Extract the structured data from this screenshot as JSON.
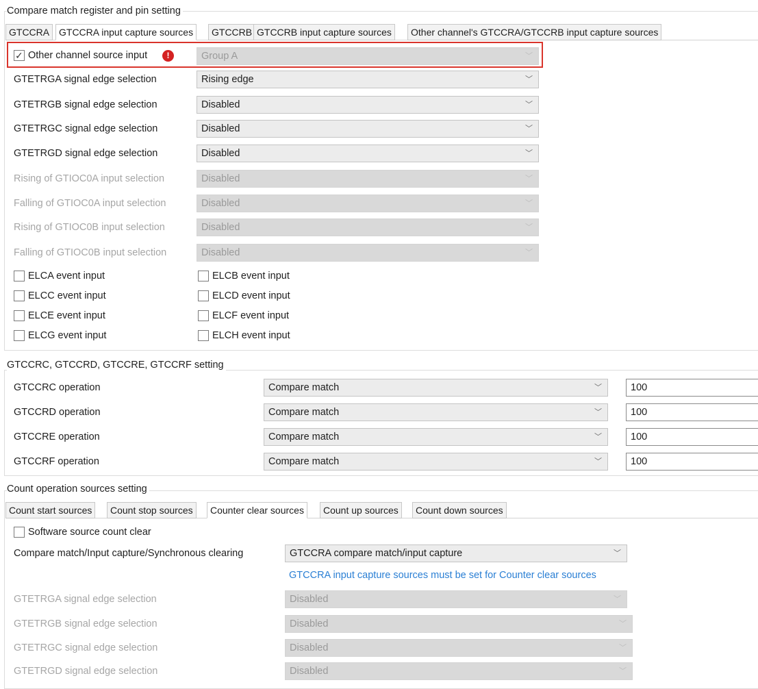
{
  "group1": {
    "title": "Compare match register and pin setting",
    "tabs": [
      "GTCCRA",
      "GTCCRA input capture sources",
      "GTCCRB",
      "GTCCRB input capture sources",
      "Other channel's GTCCRA/GTCCRB input capture sources"
    ],
    "active_tab": 1,
    "other_source": {
      "label": "Other channel source input",
      "checked": true,
      "value": "Group A"
    },
    "rows": [
      {
        "label": "GTETRGA signal edge selection",
        "value": "Rising edge",
        "enabled": true
      },
      {
        "label": "GTETRGB signal edge selection",
        "value": "Disabled",
        "enabled": true
      },
      {
        "label": "GTETRGC signal edge selection",
        "value": "Disabled",
        "enabled": true
      },
      {
        "label": "GTETRGD signal edge selection",
        "value": "Disabled",
        "enabled": true
      },
      {
        "label": "Rising of GTIOC0A input selection",
        "value": "Disabled",
        "enabled": false
      },
      {
        "label": "Falling of GTIOC0A input selection",
        "value": "Disabled",
        "enabled": false
      },
      {
        "label": "Rising of GTIOC0B input selection",
        "value": "Disabled",
        "enabled": false
      },
      {
        "label": "Falling of GTIOC0B input selection",
        "value": "Disabled",
        "enabled": false
      }
    ],
    "events_left": [
      "ELCA event input",
      "ELCC event input",
      "ELCE event input",
      "ELCG event input"
    ],
    "events_right": [
      "ELCB event input",
      "ELCD event input",
      "ELCF event input",
      "ELCH event input"
    ]
  },
  "group2": {
    "title": "GTCCRC, GTCCRD, GTCCRE, GTCCRF setting",
    "rows": [
      {
        "label": "GTCCRC operation",
        "mode": "Compare match",
        "value": "100"
      },
      {
        "label": "GTCCRD operation",
        "mode": "Compare match",
        "value": "100"
      },
      {
        "label": "GTCCRE operation",
        "mode": "Compare match",
        "value": "100"
      },
      {
        "label": "GTCCRF operation",
        "mode": "Compare match",
        "value": "100"
      }
    ]
  },
  "group3": {
    "title": "Count operation sources setting",
    "tabs": [
      "Count start sources",
      "Count stop sources",
      "Counter clear sources",
      "Count up sources",
      "Count down sources"
    ],
    "active_tab": 2,
    "software_clear": {
      "label": "Software source count clear",
      "checked": false
    },
    "clearing": {
      "label": "Compare match/Input capture/Synchronous clearing",
      "value": "GTCCRA compare match/input capture"
    },
    "info": "GTCCRA input capture sources must be set for Counter clear sources",
    "rows": [
      {
        "label": "GTETRGA signal edge selection",
        "value": "Disabled"
      },
      {
        "label": "GTETRGB signal edge selection",
        "value": "Disabled"
      },
      {
        "label": "GTETRGC signal edge selection",
        "value": "Disabled"
      },
      {
        "label": "GTETRGD signal edge selection",
        "value": "Disabled"
      }
    ]
  },
  "icons": {
    "dropdown": "chevron-down-icon",
    "check": "checkmark-icon",
    "error": "error-icon"
  },
  "colors": {
    "highlight": "#d9342b",
    "error": "#d42222",
    "info_text": "#2a7fd4"
  }
}
